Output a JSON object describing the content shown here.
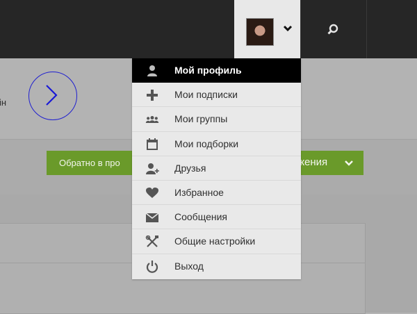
{
  "header": {
    "user_avatar_alt": "avatar",
    "dropdown_icon": "chevron-down-icon",
    "search_icon": "search-icon"
  },
  "page": {
    "cut_text": "ін",
    "green_button": {
      "left_label": "Обратно в про",
      "right_label": "жения",
      "color": "#6a9a2a"
    }
  },
  "menu": {
    "items": [
      {
        "label": "Мой профиль",
        "icon": "user-icon",
        "active": true
      },
      {
        "label": "Мои подписки",
        "icon": "plus-icon",
        "active": false
      },
      {
        "label": "Мои группы",
        "icon": "group-icon",
        "active": false
      },
      {
        "label": "Мои подборки",
        "icon": "calendar-icon",
        "active": false
      },
      {
        "label": "Друзья",
        "icon": "add-friend-icon",
        "active": false
      },
      {
        "label": "Избранное",
        "icon": "heart-icon",
        "active": false
      },
      {
        "label": "Сообщения",
        "icon": "envelope-icon",
        "active": false
      },
      {
        "label": "Общие настройки",
        "icon": "tools-icon",
        "active": false
      },
      {
        "label": "Выход",
        "icon": "power-icon",
        "active": false
      }
    ]
  },
  "colors": {
    "topbar": "#262626",
    "menu_bg": "#e9e9e9",
    "active_bg": "#000000",
    "accent_circle": "#1f1fd0"
  }
}
